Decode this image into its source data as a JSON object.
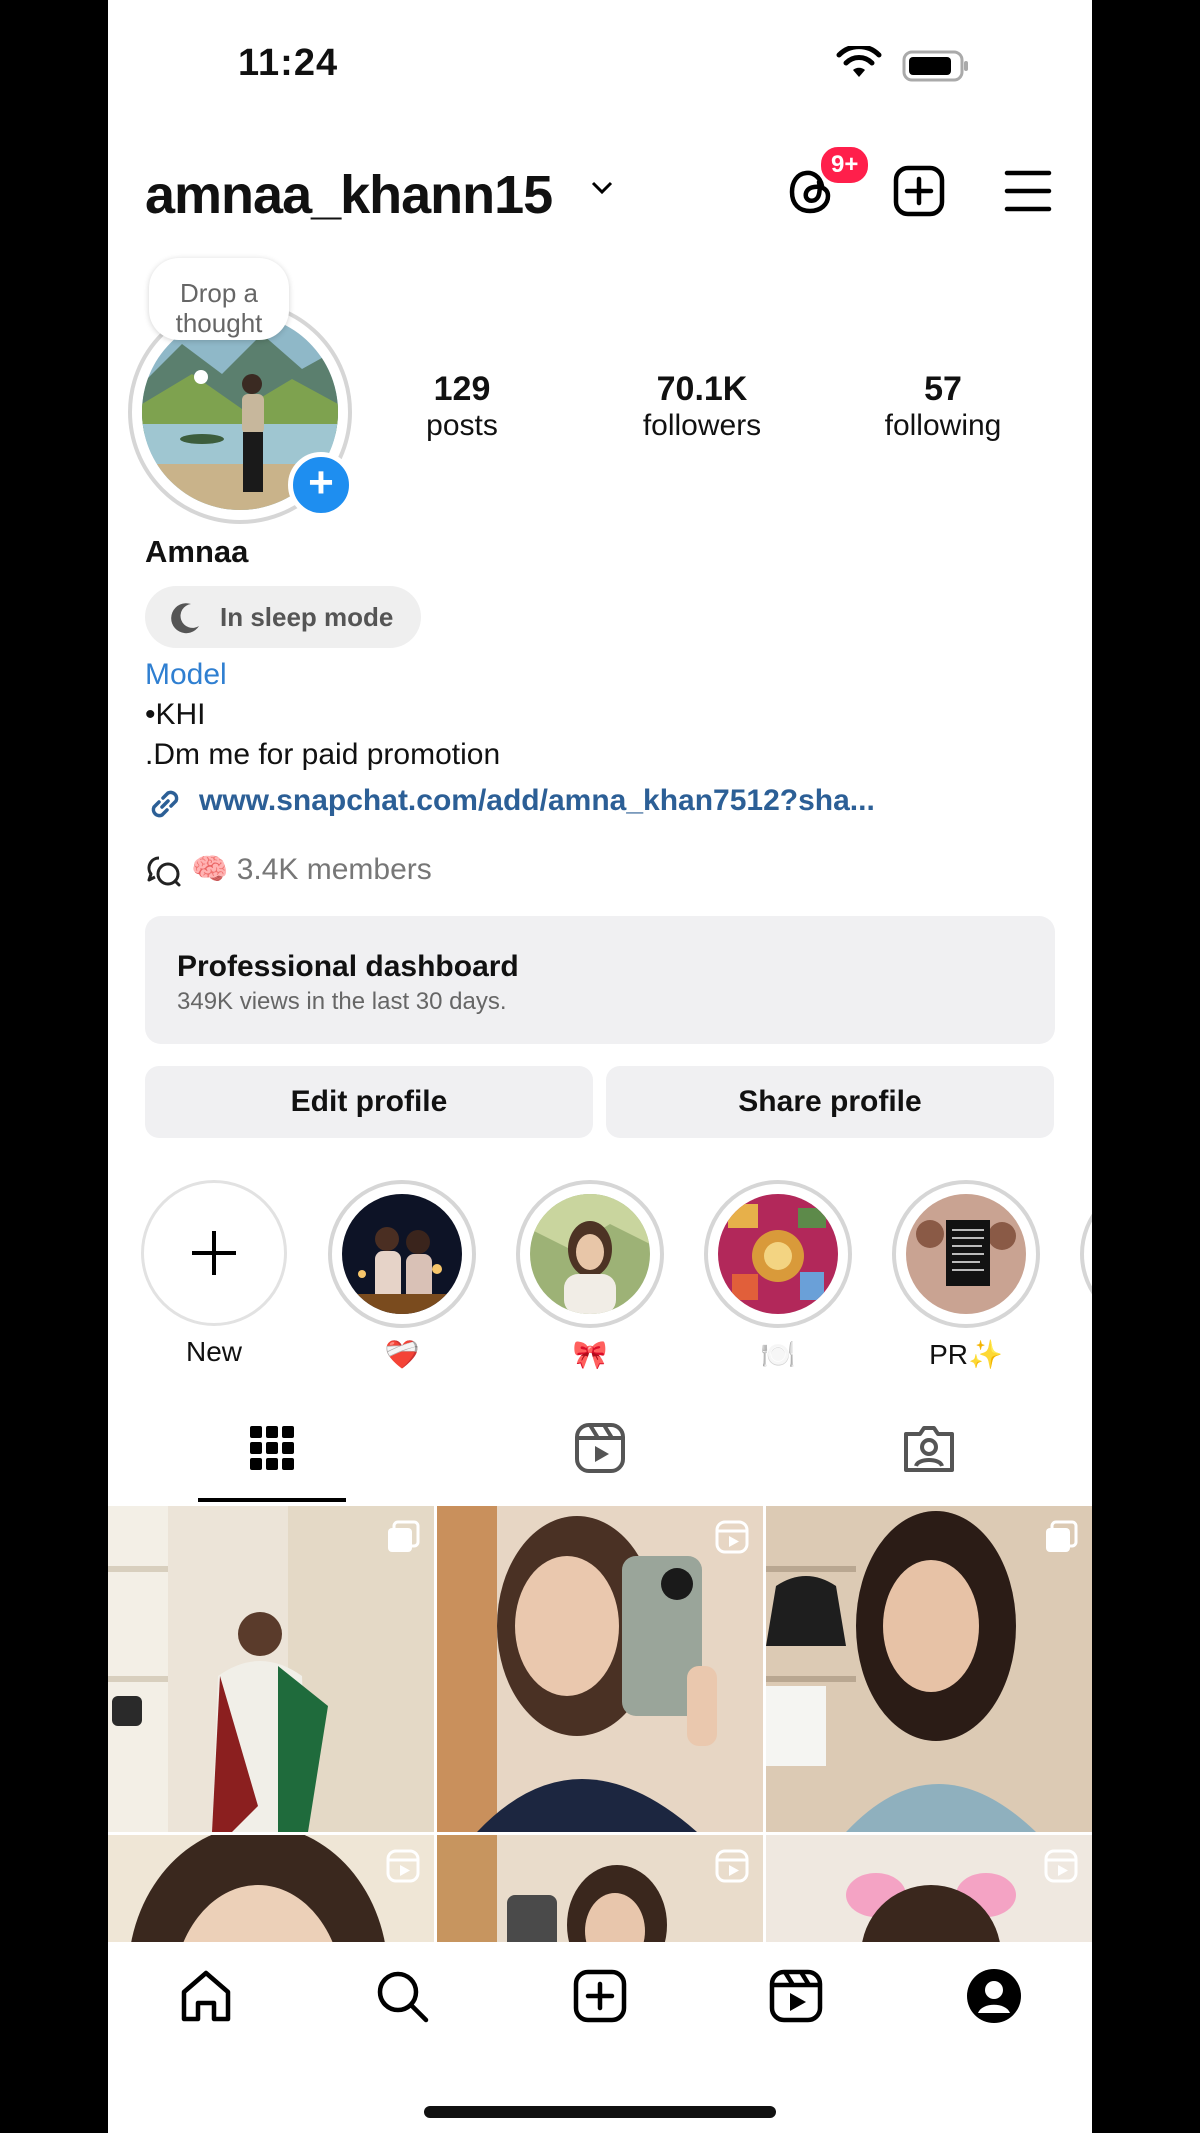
{
  "status": {
    "time": "11:24"
  },
  "header": {
    "username": "amnaa_khann15",
    "threads_badge": "9+"
  },
  "profile": {
    "thought_bubble": "Drop a thought",
    "stats": [
      {
        "value": "129",
        "label": "posts"
      },
      {
        "value": "70.1K",
        "label": "followers"
      },
      {
        "value": "57",
        "label": "following"
      }
    ],
    "name": "Amnaa",
    "sleep_status": "In sleep mode",
    "category": "Model",
    "bio_lines": [
      "•KHI",
      ".Dm me for paid promotion"
    ],
    "link": "www.snapchat.com/add/amna_khan7512?sha...",
    "channel": {
      "emoji": "🧠",
      "members": "3.4K members"
    }
  },
  "dashboard": {
    "title": "Professional dashboard",
    "subtitle": "349K views in the last 30 days."
  },
  "buttons": {
    "edit": "Edit profile",
    "share": "Share profile"
  },
  "highlights": [
    {
      "label": "New"
    },
    {
      "label": "❤️‍🩹"
    },
    {
      "label": "🎀"
    },
    {
      "label": "🍽️"
    },
    {
      "label": "PR✨"
    }
  ],
  "colors": {
    "accent_blue": "#1e8ef0",
    "badge_red": "#ff1f4b",
    "link_blue": "#2c5f96"
  }
}
